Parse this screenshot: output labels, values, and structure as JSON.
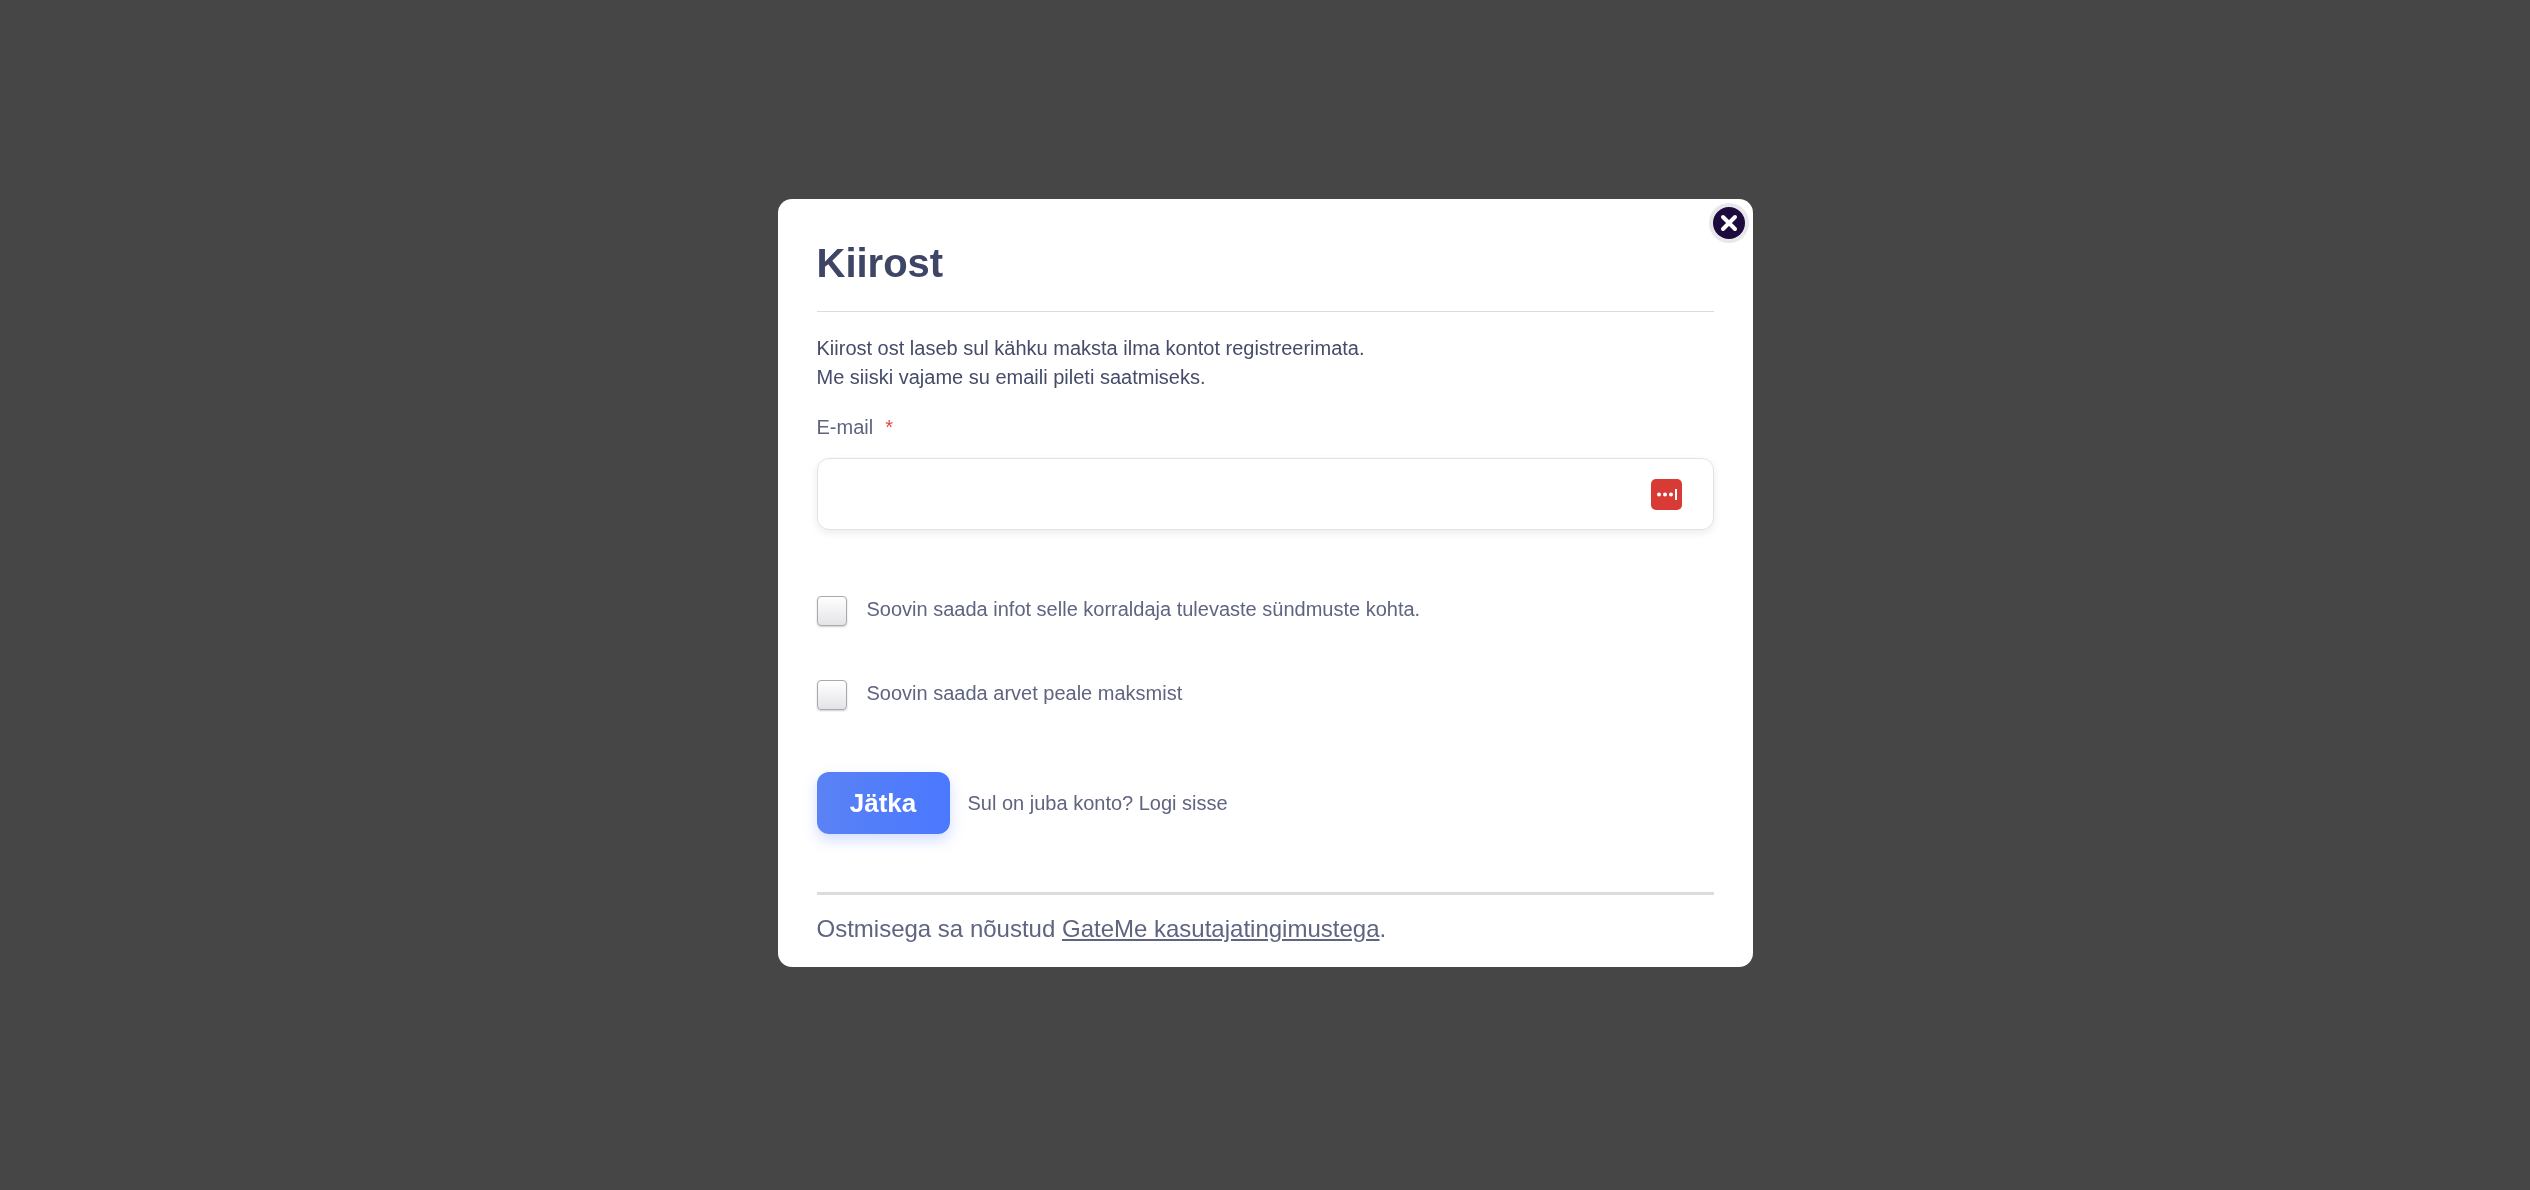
{
  "dialog": {
    "title": "Kiirost",
    "intro": [
      "Kiirost ost laseb sul kähku maksta ilma kontot registreerimata.",
      "Me siiski vajame su emaili pileti saatmiseks."
    ],
    "email": {
      "label": "E-mail",
      "required_mark": "*"
    },
    "checkboxes": [
      {
        "label": "Soovin saada infot selle korraldaja tulevaste sündmuste kohta.",
        "checked": false
      },
      {
        "label": "Soovin saada arvet peale maksmist",
        "checked": false
      }
    ],
    "submit": "Jätka",
    "login_prompt": "Sul on juba konto? Logi sisse",
    "footer": {
      "before": "Ostmisega sa nõustud ",
      "link": "GateMe kasutajatingimustega",
      "after": "."
    }
  }
}
